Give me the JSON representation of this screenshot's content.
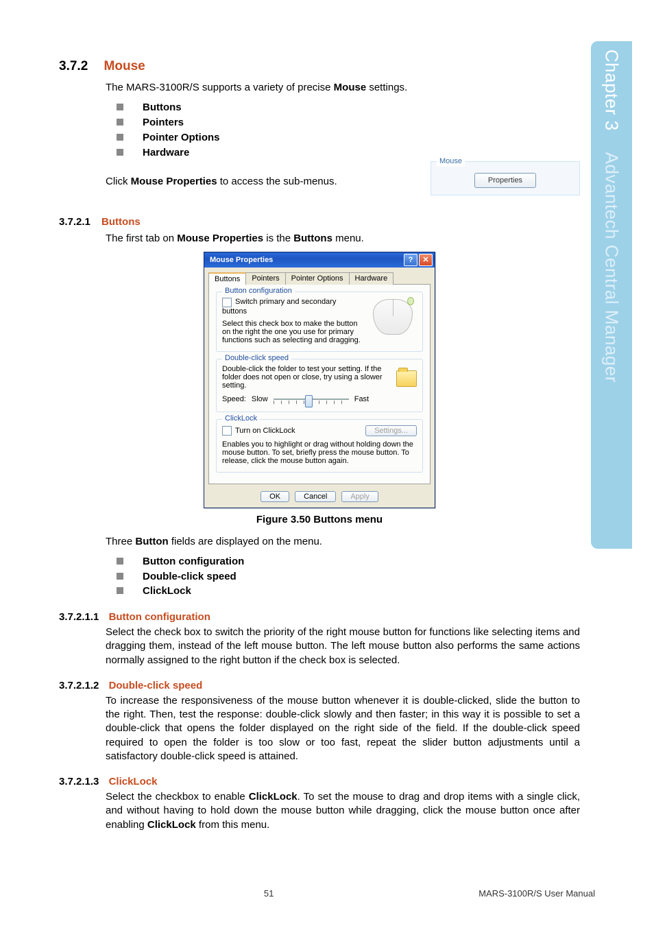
{
  "side_tab": {
    "chapter": "Chapter 3",
    "title": "Advantech Central Manager"
  },
  "sec372": {
    "num": "3.7.2",
    "title": "Mouse",
    "intro_pre": "The MARS-3100R/S supports a variety of precise ",
    "intro_bold": "Mouse",
    "intro_post": " settings.",
    "bullets": [
      "Buttons",
      "Pointers",
      "Pointer Options",
      "Hardware"
    ],
    "access_pre": "Click ",
    "access_bold": "Mouse Properties",
    "access_post": " to access the sub-menus."
  },
  "mouse_group": {
    "legend": "Mouse",
    "button": "Properties"
  },
  "sec37211": {
    "num": "3.7.2.1",
    "title": "Buttons",
    "line_pre": "The first tab on ",
    "line_b1": "Mouse Properties",
    "line_mid": " is the ",
    "line_b2": "Buttons",
    "line_post": " menu."
  },
  "dialog": {
    "title": "Mouse Properties",
    "help": "?",
    "close": "✕",
    "tabs": [
      "Buttons",
      "Pointers",
      "Pointer Options",
      "Hardware"
    ],
    "g1": {
      "title": "Button configuration",
      "chk": "Switch primary and secondary buttons",
      "desc": "Select this check box to make the button on the right the one you use for primary functions such as selecting and dragging."
    },
    "g2": {
      "title": "Double-click speed",
      "desc": "Double-click the folder to test your setting. If the folder does not open or close, try using a slower setting.",
      "speed_label": "Speed:",
      "slow": "Slow",
      "fast": "Fast"
    },
    "g3": {
      "title": "ClickLock",
      "chk": "Turn on ClickLock",
      "settings": "Settings...",
      "desc": "Enables you to highlight or drag without holding down the mouse button. To set, briefly press the mouse button. To release, click the mouse button again."
    },
    "ok": "OK",
    "cancel": "Cancel",
    "apply": "Apply"
  },
  "fig_caption": "Figure 3.50 Buttons menu",
  "three_fields": {
    "pre": "Three ",
    "b": "Button",
    "post": " fields are displayed on the menu.",
    "items": [
      "Button configuration",
      "Double-click speed",
      "ClickLock"
    ]
  },
  "s1": {
    "num": "3.7.2.1.1",
    "title": "Button configuration",
    "text": "Select the check box to switch the priority of the right mouse button for functions like selecting items and dragging them, instead of the left mouse button. The left mouse button also performs the same actions normally assigned to the right button if the check box is selected."
  },
  "s2": {
    "num": "3.7.2.1.2",
    "title": "Double-click speed",
    "text": "To increase the responsiveness of the mouse button whenever it is double-clicked, slide the button to the right. Then, test the response: double-click slowly and then faster; in this way it is possible to set a double-click that opens the folder displayed on the right side of the field. If the double-click speed required to open the folder is too slow or too fast, repeat the slider button adjustments until a satisfactory double-click speed is attained."
  },
  "s3": {
    "num": "3.7.2.1.3",
    "title": "ClickLock",
    "p1a": "Select the checkbox to enable ",
    "p1b": "ClickLock",
    "p1c": ". To set the mouse to drag and drop items with a single click, and without having to hold down the mouse button while dragging, click the mouse button once after enabling ",
    "p1d": "ClickLock",
    "p1e": " from this menu."
  },
  "footer": {
    "page": "51",
    "manual": "MARS-3100R/S User Manual"
  }
}
